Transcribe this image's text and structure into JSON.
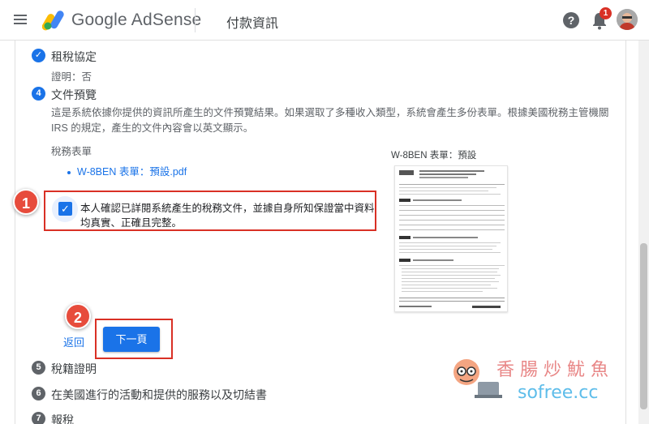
{
  "header": {
    "app_name": "Google AdSense",
    "page_title": "付款資訊",
    "help_icon": "help-circle-icon",
    "notifications_count": "1"
  },
  "steps": {
    "tax_agreement": {
      "title": "租稅協定",
      "sub": "證明：否"
    },
    "doc_preview": {
      "number": "4",
      "title": "文件預覽",
      "description": "這是系統依據你提供的資訊所產生的文件預覽結果。如果選取了多種收入類型，系統會產生多份表單。根據美國稅務主管機關 IRS 的規定，產生的文件內容會以英文顯示。",
      "forms_heading": "稅務表單",
      "form_link": "W-8BEN 表單：預設.pdf",
      "preview_label": "W-8BEN 表單：預設",
      "confirm_text": "本人確認已詳閱系統產生的稅務文件，並據自身所知保證當中資料均真實、正確且完整。",
      "confirm_checked": true,
      "back_label": "返回",
      "next_label": "下一頁"
    },
    "tax_residency": {
      "number": "5",
      "title": "稅籍證明"
    },
    "us_activities": {
      "number": "6",
      "title": "在美國進行的活動和提供的服務以及切結書"
    },
    "tax_report": {
      "number": "7",
      "title": "報稅"
    }
  },
  "annotations": {
    "badge1": "1",
    "badge2": "2"
  },
  "watermark": {
    "cn": "香腸炒魷魚",
    "en": "sofree.cc"
  },
  "colors": {
    "accent": "#1a73e8",
    "highlight": "#d93025"
  }
}
